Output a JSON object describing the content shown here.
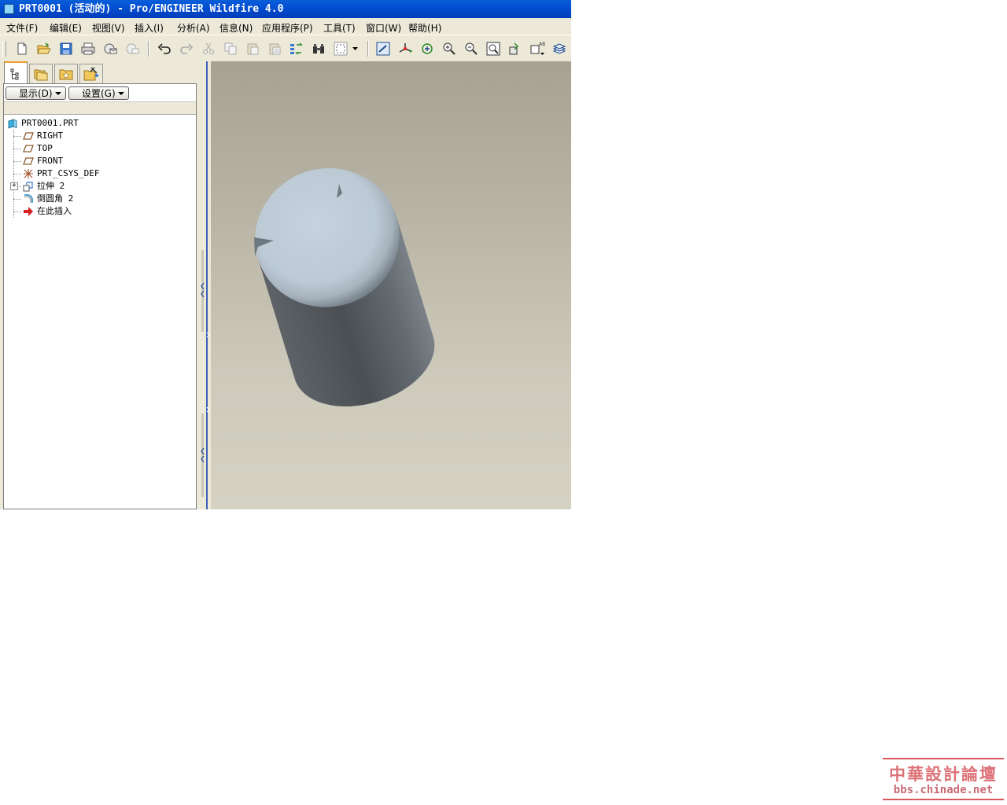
{
  "window": {
    "title": "PRT0001 (活动的) - Pro/ENGINEER Wildfire 4.0"
  },
  "menubar": {
    "items": [
      {
        "label": "文件(F)"
      },
      {
        "label": "编辑(E)"
      },
      {
        "label": "视图(V)"
      },
      {
        "label": "插入(I)"
      },
      {
        "label": "分析(A)"
      },
      {
        "label": "信息(N)"
      },
      {
        "label": "应用程序(P)"
      },
      {
        "label": "工具(T)"
      },
      {
        "label": "窗口(W)"
      },
      {
        "label": "帮助(H)"
      }
    ]
  },
  "toolbar": {
    "icons": [
      "new-file-icon",
      "open-folder-icon",
      "save-icon",
      "print-icon",
      "send-mail-icon",
      "close-window-icon",
      "undo-icon",
      "redo-icon",
      "cut-icon",
      "copy-icon",
      "paste-icon",
      "paste-special-icon",
      "regenerate-icon",
      "find-icon",
      "selection-box-icon",
      "dropdown-arrow-icon",
      "repaint-icon",
      "spin-center-icon",
      "orient-icon",
      "zoom-in-icon",
      "zoom-out-icon",
      "refit-icon",
      "view-manager-icon",
      "saved-views-icon",
      "layers-icon"
    ]
  },
  "nav_tabs": {
    "icons": [
      "model-tree-icon",
      "folder-browser-icon",
      "favorites-icon",
      "connections-icon"
    ]
  },
  "model_tree": {
    "show_button": "显示(D)",
    "settings_button": "设置(G)",
    "root": "PRT0001.PRT",
    "items": [
      {
        "label": "RIGHT",
        "icon": "datum-plane-icon"
      },
      {
        "label": "TOP",
        "icon": "datum-plane-icon"
      },
      {
        "label": "FRONT",
        "icon": "datum-plane-icon"
      },
      {
        "label": "PRT_CSYS_DEF",
        "icon": "coordinate-system-icon"
      },
      {
        "label": "拉伸 2",
        "icon": "extrude-icon"
      },
      {
        "label": "倒圆角 2",
        "icon": "round-icon"
      },
      {
        "label": "在此插入",
        "icon": "insert-here-arrow-icon"
      }
    ]
  },
  "watermark": {
    "title": "中華設計論壇",
    "url": "bbs.chinade.net"
  },
  "colors": {
    "titlebar": "#0453d6",
    "chrome": "#ece9d8",
    "viewport_top": "#a6a294",
    "viewport_bottom": "#d5d2c4",
    "watermark": "#d2444c"
  }
}
